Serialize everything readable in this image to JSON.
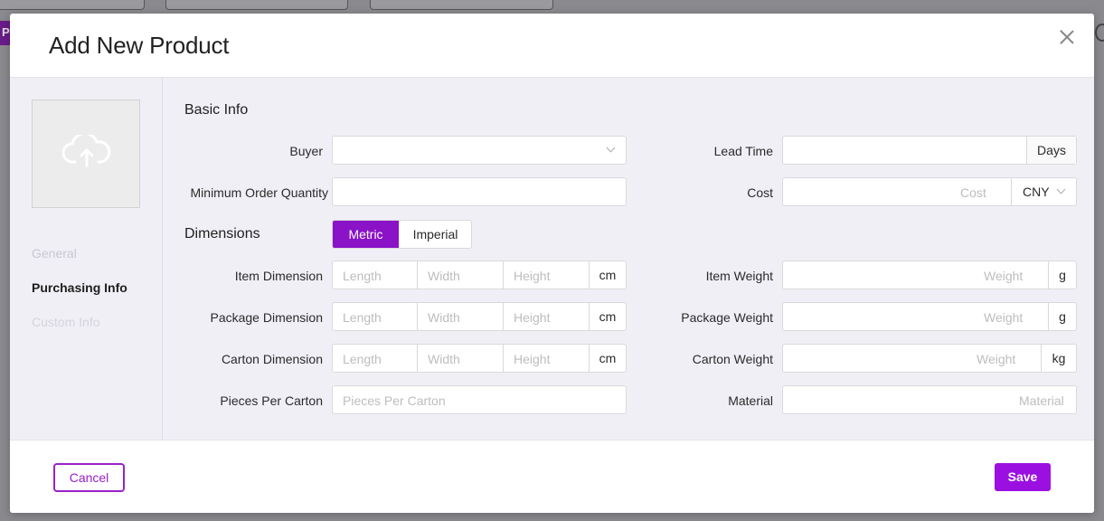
{
  "dialog": {
    "title": "Add New Product",
    "accent_color": "#8a12c7"
  },
  "nav": {
    "items": [
      {
        "label": "General",
        "state": "disabled"
      },
      {
        "label": "Purchasing Info",
        "state": "active"
      },
      {
        "label": "Custom Info",
        "state": "disabled"
      }
    ]
  },
  "basic_info": {
    "title": "Basic Info",
    "buyer": {
      "label": "Buyer",
      "value": ""
    },
    "moq": {
      "label": "Minimum Order Quantity",
      "value": ""
    },
    "lead_time": {
      "label": "Lead Time",
      "value": "",
      "unit": "Days"
    },
    "cost": {
      "label": "Cost",
      "placeholder": "Cost",
      "currency": "CNY"
    }
  },
  "dimensions": {
    "title": "Dimensions",
    "toggle": {
      "metric": "Metric",
      "imperial": "Imperial",
      "selected": "Metric"
    },
    "placeholders": {
      "length": "Length",
      "width": "Width",
      "height": "Height",
      "weight": "Weight"
    },
    "item_dimension": {
      "label": "Item Dimension",
      "unit": "cm"
    },
    "package_dimension": {
      "label": "Package Dimension",
      "unit": "cm"
    },
    "carton_dimension": {
      "label": "Carton Dimension",
      "unit": "cm"
    },
    "pieces_per_carton": {
      "label": "Pieces Per Carton",
      "placeholder": "Pieces Per Carton"
    },
    "item_weight": {
      "label": "Item Weight",
      "unit": "g"
    },
    "package_weight": {
      "label": "Package Weight",
      "unit": "g"
    },
    "carton_weight": {
      "label": "Carton Weight",
      "unit": "kg"
    },
    "material": {
      "label": "Material",
      "placeholder": "Material"
    }
  },
  "footer": {
    "cancel_label": "Cancel",
    "save_label": "Save"
  },
  "backdrop": {
    "fragment_letter": "P"
  }
}
